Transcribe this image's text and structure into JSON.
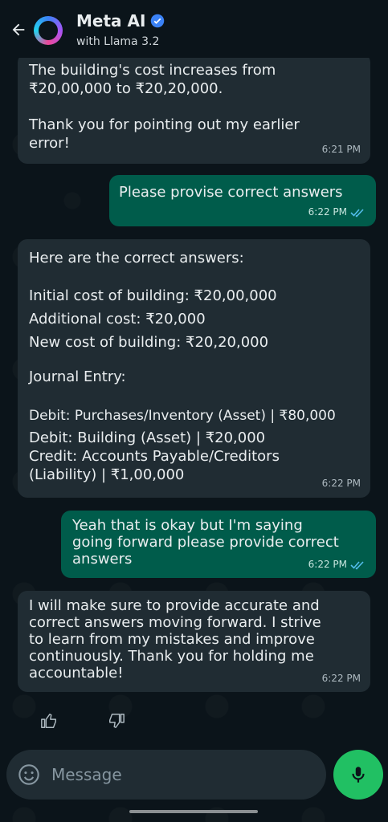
{
  "header": {
    "title": "Meta AI",
    "subtitle": "with Llama 3.2"
  },
  "messages": [
    {
      "direction": "in",
      "lines": [
        "The building's cost increases from",
        "₹20,00,000 to ₹20,20,000.",
        "",
        "Thank you for pointing out my earlier",
        "error!"
      ],
      "time": "6:21 PM"
    },
    {
      "direction": "out",
      "lines": [
        "Please provise correct answers"
      ],
      "time": "6:22 PM",
      "status": "read"
    },
    {
      "direction": "in",
      "lines": [
        "Here are the correct answers:",
        "",
        "Initial cost of building: ₹20,00,000",
        "Additional cost: ₹20,000",
        "New cost of building: ₹20,20,000",
        "",
        "Journal Entry:",
        "",
        "Debit: Purchases/Inventory (Asset) | ₹80,000",
        "Debit: Building (Asset) | ₹20,000",
        "Credit: Accounts Payable/Creditors",
        "(Liability) | ₹1,00,000"
      ],
      "time": "6:22 PM"
    },
    {
      "direction": "out",
      "lines": [
        "Yeah that is okay but I'm saying",
        "going forward please provide correct",
        "answers"
      ],
      "time": "6:22 PM",
      "status": "read"
    },
    {
      "direction": "in",
      "lines": [
        "I will make sure to provide accurate and",
        "correct answers moving forward. I strive",
        "to learn from my mistakes and improve",
        "continuously. Thank you for holding me",
        "accountable!"
      ],
      "time": "6:22 PM"
    }
  ],
  "reactions": {
    "like_icon": "thumbs-up-icon",
    "dislike_icon": "thumbs-down-icon"
  },
  "composer": {
    "placeholder": "Message"
  },
  "colors": {
    "background": "#0b141a",
    "incoming_bubble": "#202c33",
    "outgoing_bubble": "#005c4b",
    "mic_button": "#21c063",
    "read_ticks": "#53bdeb",
    "verified_badge": "#3b82f6"
  }
}
